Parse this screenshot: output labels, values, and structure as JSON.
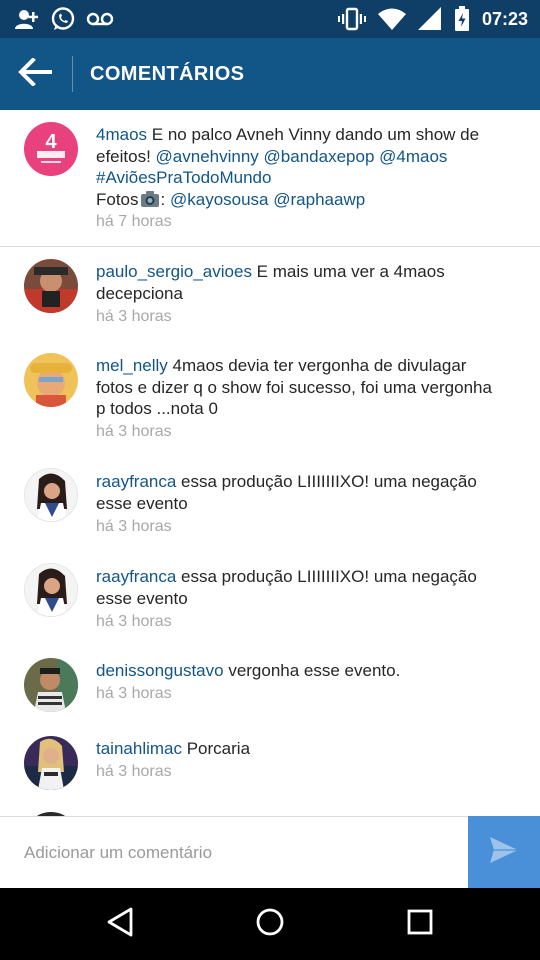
{
  "status_bar": {
    "time": "07:23",
    "icons": [
      "add-contact-icon",
      "whatsapp-icon",
      "voicemail-icon",
      "vibrate-icon",
      "wifi-icon",
      "signal-icon",
      "battery-charging-icon"
    ]
  },
  "action_bar": {
    "title": "COMENTÁRIOS",
    "back_icon": "arrow-left-icon"
  },
  "caption": {
    "username": "4maos",
    "text_1": " E no palco Avneh Vinny dando um show de efeitos! ",
    "mention_1": "@avnehvinny",
    "mention_2": "@bandaxepop",
    "mention_3": "@4maos",
    "hashtag": "#AviõesPraTodoMundo",
    "fotos_label": "Fotos",
    "fotos_suffix": ": ",
    "mention_4": "@kayosousa",
    "mention_5": "@raphaawp",
    "time": "há 7 horas"
  },
  "comments": [
    {
      "username": "paulo_sergio_avioes",
      "text": " E mais uma ver a 4maos decepciona",
      "time": "há 3 horas"
    },
    {
      "username": "mel_nelly",
      "text": " 4maos devia ter vergonha de divulagar fotos e dizer q o show foi sucesso, foi uma vergonha p todos ...nota 0",
      "time": "há 3 horas"
    },
    {
      "username": "raayfranca",
      "text": " essa produção LIIIIIIIXO! uma negação esse evento",
      "time": "há 3 horas"
    },
    {
      "username": "raayfranca",
      "text": " essa produção LIIIIIIIXO! uma negação esse evento",
      "time": "há 3 horas"
    },
    {
      "username": "denissongustavo",
      "text": " vergonha esse evento.",
      "time": "há 3 horas"
    },
    {
      "username": "tainahlimac",
      "text": " Porcaria",
      "time": "há 3 horas"
    }
  ],
  "input": {
    "placeholder": "Adicionar um comentário",
    "value": ""
  },
  "nav_bar": {
    "icons": [
      "back-triangle-icon",
      "home-circle-icon",
      "recents-square-icon"
    ]
  },
  "colors": {
    "status_bar": "#0f3f66",
    "action_bar": "#125688",
    "link": "#125688",
    "timestamp": "#a8a8a8",
    "send_button": "#4a90d9"
  }
}
